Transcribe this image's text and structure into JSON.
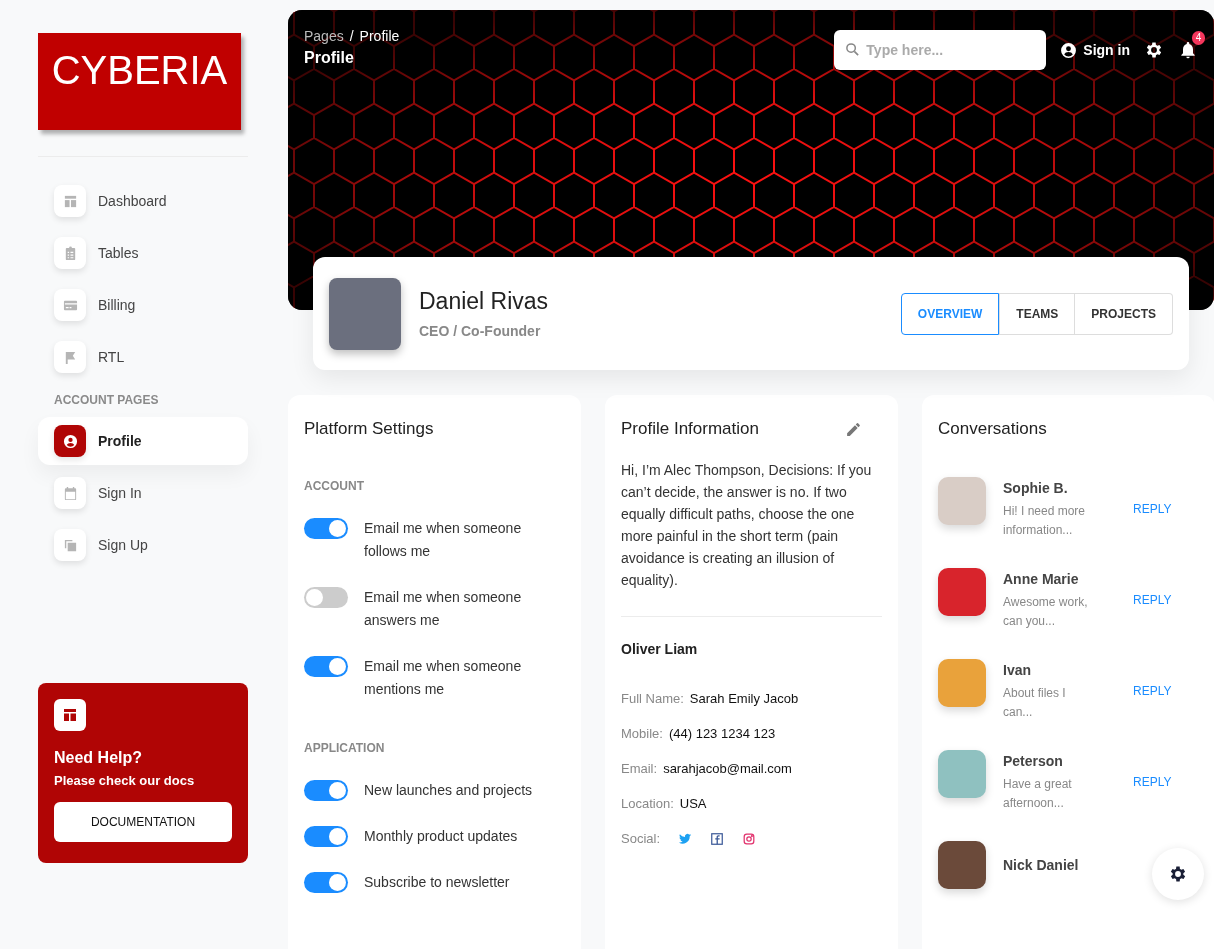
{
  "logo": {
    "text": "CYBERIA"
  },
  "nav": [
    {
      "label": "Dashboard",
      "kind": "dashboard",
      "selected": false
    },
    {
      "label": "Tables",
      "kind": "tables",
      "selected": false
    },
    {
      "label": "Billing",
      "kind": "billing",
      "selected": false
    },
    {
      "label": "RTL",
      "kind": "rtl",
      "selected": false
    }
  ],
  "account_heading": "ACCOUNT PAGES",
  "account_nav": [
    {
      "label": "Profile",
      "kind": "profile",
      "selected": true
    },
    {
      "label": "Sign In",
      "kind": "signin",
      "selected": false
    },
    {
      "label": "Sign Up",
      "kind": "signup",
      "selected": false
    }
  ],
  "help": {
    "title": "Need Help?",
    "text": "Please check our docs",
    "button": "DOCUMENTATION"
  },
  "header": {
    "breadcrumb": [
      "Pages",
      "Profile"
    ],
    "separator": "/",
    "title": "Profile",
    "search": {
      "placeholder": "Type here..."
    },
    "sign_in": "Sign in",
    "notification_count": "4"
  },
  "profile": {
    "name": "Daniel Rivas",
    "role": "CEO / Co-Founder",
    "tabs": [
      {
        "label": "OVERVIEW",
        "selected": true
      },
      {
        "label": "TEAMS",
        "selected": false
      },
      {
        "label": "PROJECTS",
        "selected": false
      }
    ]
  },
  "platform_settings": {
    "title": "Platform Settings",
    "groups": [
      {
        "title": "ACCOUNT",
        "items": [
          {
            "label": "Email me when someone follows me",
            "on": true
          },
          {
            "label": "Email me when someone answers me",
            "on": false
          },
          {
            "label": "Email me when someone mentions me",
            "on": true
          }
        ]
      },
      {
        "title": "APPLICATION",
        "items": [
          {
            "label": "New launches and projects",
            "on": true
          },
          {
            "label": "Monthly product updates",
            "on": true
          },
          {
            "label": "Subscribe to newsletter",
            "on": true
          }
        ]
      }
    ]
  },
  "profile_info": {
    "title": "Profile Information",
    "bio": "Hi, I’m Alec Thompson, Decisions: If you can’t decide, the answer is no. If two equally difficult paths, choose the one more painful in the short term (pain avoidance is creating an illusion of equality).",
    "name": "Oliver Liam",
    "fields": [
      {
        "label": "Full Name:",
        "value": "Sarah Emily Jacob"
      },
      {
        "label": "Mobile:",
        "value": "(44) 123 1234 123"
      },
      {
        "label": "Email:",
        "value": "sarahjacob@mail.com"
      },
      {
        "label": "Location:",
        "value": "USA"
      }
    ],
    "social_label": "Social:",
    "socials": [
      {
        "kind": "twitter"
      },
      {
        "kind": "facebook"
      },
      {
        "kind": "instagram"
      }
    ]
  },
  "conversations": {
    "title": "Conversations",
    "items": [
      {
        "name": "Sophie B.",
        "message": "Hi! I need more information...",
        "action": "REPLY"
      },
      {
        "name": "Anne Marie",
        "message": "Awesome work, can you...",
        "action": "REPLY"
      },
      {
        "name": "Ivan",
        "message": "About files I can...",
        "action": "REPLY"
      },
      {
        "name": "Peterson",
        "message": "Have a great afternoon...",
        "action": "REPLY"
      },
      {
        "name": "Nick Daniel"
      }
    ]
  }
}
